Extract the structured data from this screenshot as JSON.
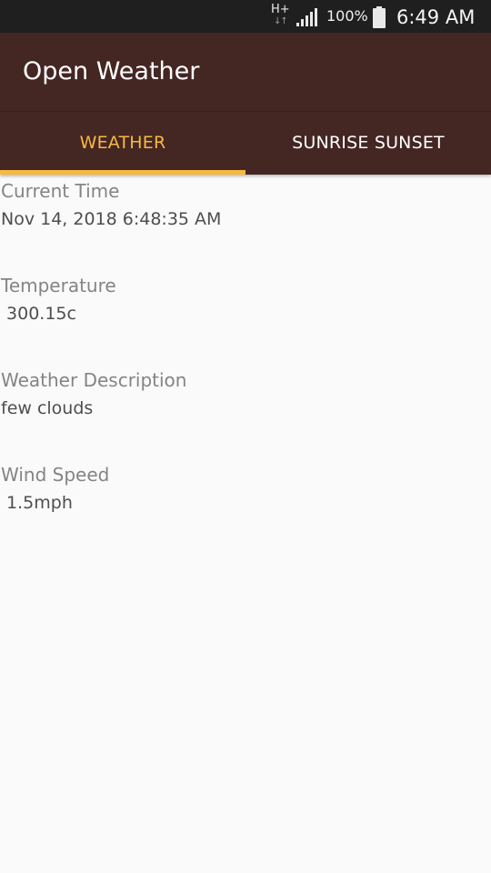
{
  "status_bar": {
    "network_type": "H+",
    "battery_percent": "100%",
    "time": "6:49 AM"
  },
  "app_bar": {
    "title": "Open Weather"
  },
  "tabs": [
    {
      "label": "WEATHER",
      "selected": true
    },
    {
      "label": "SUNRISE SUNSET",
      "selected": false
    }
  ],
  "weather": {
    "current_time": {
      "label": "Current Time",
      "value": "Nov 14, 2018 6:48:35 AM"
    },
    "temperature": {
      "label": "Temperature",
      "value": " 300.15c"
    },
    "description": {
      "label": "Weather Description",
      "value": "few clouds"
    },
    "wind_speed": {
      "label": "Wind Speed",
      "value": " 1.5mph"
    }
  },
  "colors": {
    "primary": "#442623",
    "accent": "#f9b93e",
    "status_bar": "#1f1f1f",
    "background": "#fafafa"
  },
  "icons": [
    "signal-strength-icon",
    "battery-full-icon",
    "network-arrows-icon"
  ]
}
